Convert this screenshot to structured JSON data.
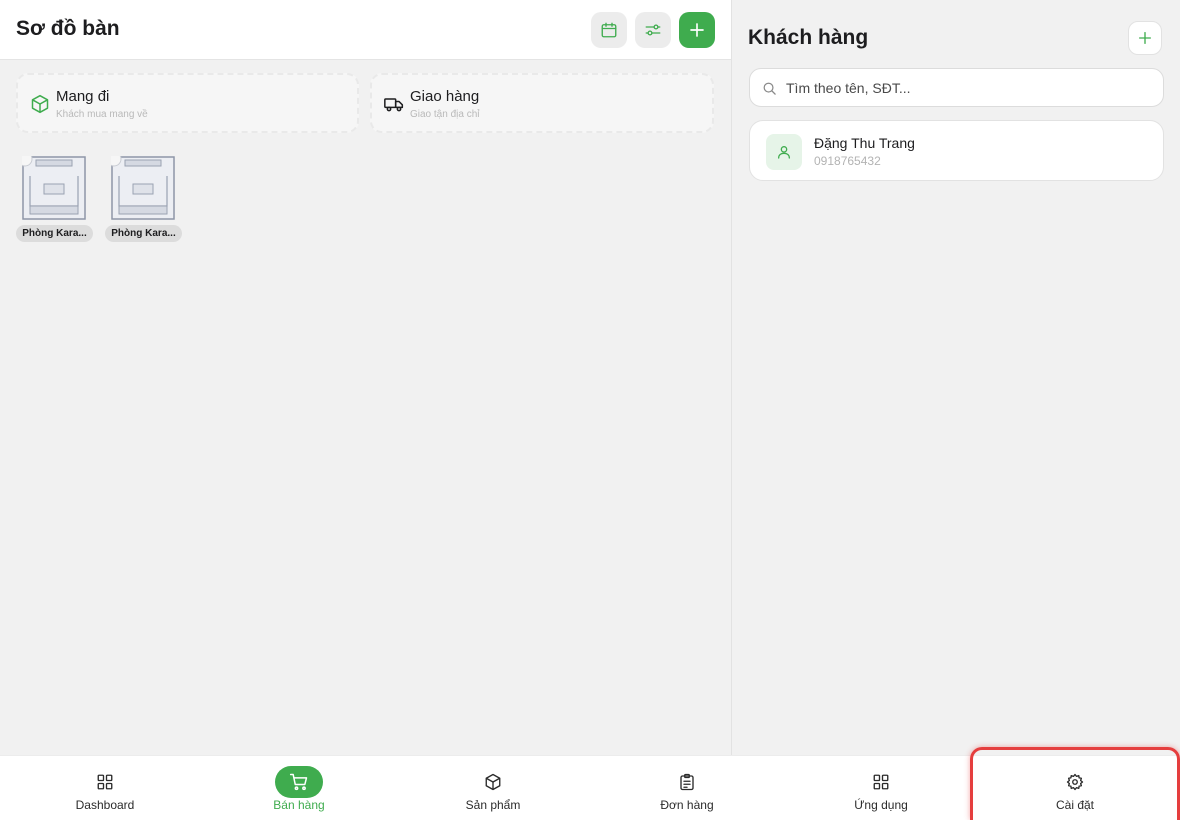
{
  "left": {
    "title": "Sơ đồ bàn",
    "quick_actions": [
      {
        "title": "Mang đi",
        "subtitle": "Khách mua mang về",
        "icon": "box-icon"
      },
      {
        "title": "Giao hàng",
        "subtitle": "Giao tận địa chỉ",
        "icon": "truck-icon"
      }
    ],
    "tables": [
      {
        "label": "Phòng Kara..."
      },
      {
        "label": "Phòng Kara..."
      }
    ]
  },
  "right": {
    "title": "Khách hàng",
    "search_placeholder": "Tìm theo tên, SĐT...",
    "customers": [
      {
        "name": "Đặng Thu Trang",
        "phone": "0918765432"
      }
    ]
  },
  "bottom_nav": [
    {
      "label": "Dashboard",
      "icon": "grid-icon"
    },
    {
      "label": "Bán hàng",
      "icon": "cart-icon",
      "active": true
    },
    {
      "label": "Sản phẩm",
      "icon": "box-icon"
    },
    {
      "label": "Đơn hàng",
      "icon": "clipboard-icon"
    },
    {
      "label": "Ứng dụng",
      "icon": "apps-icon"
    },
    {
      "label": "Cài đặt",
      "icon": "gear-icon"
    }
  ],
  "colors": {
    "accent": "#3fac4e",
    "highlight": "#e53e3e"
  }
}
